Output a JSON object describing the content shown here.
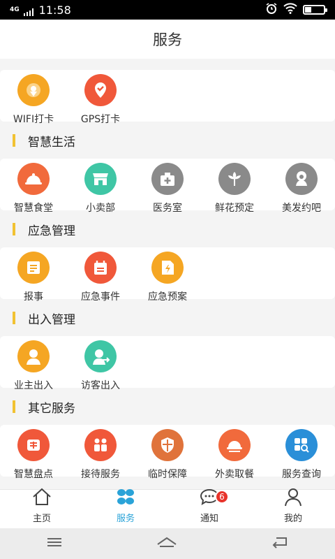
{
  "status_bar": {
    "network": "4G",
    "time": "11:58",
    "battery_level": 0.35
  },
  "header": {
    "title": "服务"
  },
  "checkin": {
    "items": [
      {
        "label": "WIFI打卡",
        "icon": "map-pin-icon",
        "color": "#f5a623"
      },
      {
        "label": "GPS打卡",
        "icon": "location-check-icon",
        "color": "#f0583a"
      }
    ]
  },
  "sections": [
    {
      "title": "智慧生活",
      "items": [
        {
          "label": "智慧食堂",
          "icon": "dish-cover-icon",
          "color": "#f16a3c"
        },
        {
          "label": "小卖部",
          "icon": "shop-icon",
          "color": "#3fc6a5"
        },
        {
          "label": "医务室",
          "icon": "medicine-box-icon",
          "color": "#8a8a8a"
        },
        {
          "label": "鲜花预定",
          "icon": "flower-icon",
          "color": "#8a8a8a"
        },
        {
          "label": "美发约吧",
          "icon": "hairdresser-icon",
          "color": "#8a8a8a"
        }
      ]
    },
    {
      "title": "应急管理",
      "items": [
        {
          "label": "报事",
          "icon": "report-icon",
          "color": "#f5a623"
        },
        {
          "label": "应急事件",
          "icon": "calendar-alert-icon",
          "color": "#f0583a"
        },
        {
          "label": "应急预案",
          "icon": "plan-document-icon",
          "color": "#f5a623"
        }
      ]
    },
    {
      "title": "出入管理",
      "items": [
        {
          "label": "业主出入",
          "icon": "owner-person-icon",
          "color": "#f5a623"
        },
        {
          "label": "访客出入",
          "icon": "visitor-person-icon",
          "color": "#3fc6a5"
        }
      ]
    },
    {
      "title": "其它服务",
      "items": [
        {
          "label": "智慧盘点",
          "icon": "inventory-pan-icon",
          "color": "#f0583a"
        },
        {
          "label": "接待服务",
          "icon": "reception-icon",
          "color": "#f0583a"
        },
        {
          "label": "临时保障",
          "icon": "shield-icon",
          "color": "#e0733b"
        },
        {
          "label": "外卖取餐",
          "icon": "takeout-icon",
          "color": "#f16a3c"
        },
        {
          "label": "服务查询",
          "icon": "search-grid-icon",
          "color": "#2a8fd8"
        }
      ]
    }
  ],
  "tabbar": {
    "tabs": [
      {
        "label": "主页",
        "icon": "home-icon",
        "active": false
      },
      {
        "label": "服务",
        "icon": "services-grid-icon",
        "active": true
      },
      {
        "label": "通知",
        "icon": "chat-bubble-icon",
        "active": false,
        "badge": "6"
      },
      {
        "label": "我的",
        "icon": "user-icon",
        "active": false
      }
    ]
  },
  "system_nav": {
    "buttons": [
      "menu-icon",
      "home-outline-icon",
      "back-icon"
    ]
  },
  "colors": {
    "accent": "#2aa3d8",
    "section_bar": "#f1c232",
    "badge": "#e8332b"
  }
}
